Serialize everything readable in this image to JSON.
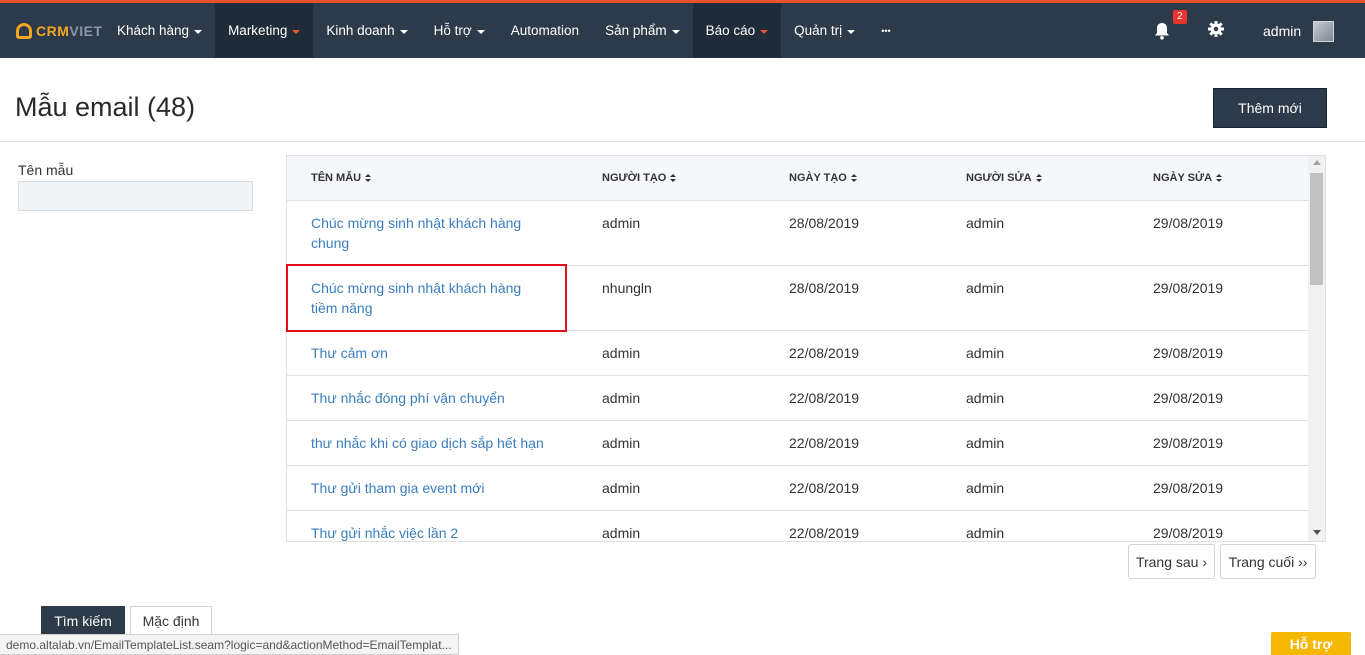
{
  "brand": {
    "part1": "CRM",
    "part2": "VIET"
  },
  "nav": {
    "items": [
      {
        "label": "Khách hàng"
      },
      {
        "label": "Marketing"
      },
      {
        "label": "Kinh doanh"
      },
      {
        "label": "Hỗ trợ"
      },
      {
        "label": "Automation"
      },
      {
        "label": "Sản phẩm"
      },
      {
        "label": "Báo cáo"
      },
      {
        "label": "Quản trị"
      },
      {
        "label": "•••"
      }
    ],
    "notification_count": "2",
    "user": "admin"
  },
  "page": {
    "title": "Mẫu email (48)",
    "add_button": "Thêm mới"
  },
  "filter": {
    "label": "Tên mẫu",
    "value": ""
  },
  "table": {
    "columns": [
      "TÊN MẪU",
      "NGƯỜI TẠO",
      "NGÀY TẠO",
      "NGƯỜI SỬA",
      "NGÀY SỬA"
    ],
    "rows": [
      {
        "name": "Chúc mừng sinh nhật khách hàng chung",
        "creator": "admin",
        "created": "28/08/2019",
        "editor": "admin",
        "edited": "29/08/2019"
      },
      {
        "name": "Chúc mừng sinh nhật khách hàng tiềm năng",
        "creator": "nhungln",
        "created": "28/08/2019",
        "editor": "admin",
        "edited": "29/08/2019"
      },
      {
        "name": "Thư cảm ơn",
        "creator": "admin",
        "created": "22/08/2019",
        "editor": "admin",
        "edited": "29/08/2019"
      },
      {
        "name": "Thư nhắc đóng phí vận chuyển",
        "creator": "admin",
        "created": "22/08/2019",
        "editor": "admin",
        "edited": "29/08/2019"
      },
      {
        "name": "thư nhắc khi có giao dịch sắp hết hạn",
        "creator": "admin",
        "created": "22/08/2019",
        "editor": "admin",
        "edited": "29/08/2019"
      },
      {
        "name": "Thư gửi tham gia event mới",
        "creator": "admin",
        "created": "22/08/2019",
        "editor": "admin",
        "edited": "29/08/2019"
      },
      {
        "name": "Thư gửi nhắc việc lần 2",
        "creator": "admin",
        "created": "22/08/2019",
        "editor": "admin",
        "edited": "29/08/2019"
      }
    ]
  },
  "pager": {
    "next": "Trang sau ›",
    "last": "Trang cuối ››"
  },
  "actions": {
    "search": "Tìm kiếm",
    "default": "Mặc định"
  },
  "status_bar": {
    "url": "demo.altalab.vn/EmailTemplateList.seam?logic=and&actionMethod=EmailTemplat..."
  },
  "help": {
    "label": "Hỗ trợ"
  },
  "colors": {
    "topbar": "#2d3a4a",
    "accent": "#e8532f",
    "link": "#3a7ebf",
    "highlight": "#e0101a",
    "help": "#f5b800"
  }
}
